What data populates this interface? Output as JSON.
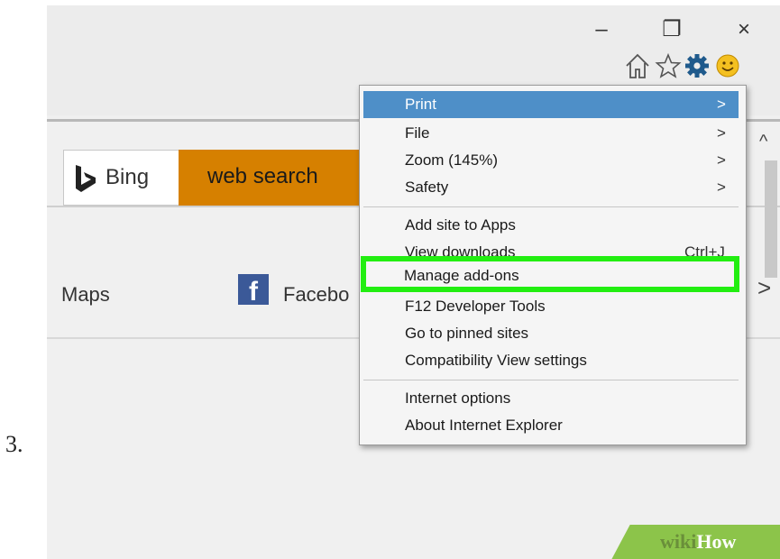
{
  "step_number": "3.",
  "window_controls": {
    "minimize": "–",
    "restore": "❐",
    "close": "×"
  },
  "toolbar_icons": [
    "home-icon",
    "star-icon",
    "gear-icon",
    "smiley-icon"
  ],
  "search": {
    "brand": "Bing",
    "button": "web search"
  },
  "favorites": {
    "maps": "Maps",
    "facebook_glyph": "f",
    "facebook_label": "Facebo"
  },
  "menu": {
    "items": [
      {
        "label": "Print",
        "arrow": ">"
      },
      {
        "label": "File",
        "arrow": ">"
      },
      {
        "label": "Zoom (145%)",
        "arrow": ">"
      },
      {
        "label": "Safety",
        "arrow": ">"
      },
      {
        "label": "Add site to Apps"
      },
      {
        "label": "View downloads",
        "shortcut": "Ctrl+J"
      },
      {
        "label": "Manage add-ons"
      },
      {
        "label": "F12 Developer Tools"
      },
      {
        "label": "Go to pinned sites"
      },
      {
        "label": "Compatibility View settings"
      },
      {
        "label": "Internet options"
      },
      {
        "label": "About Internet Explorer"
      }
    ]
  },
  "scroll": {
    "up": "^",
    "right": ">"
  },
  "watermark": {
    "wiki": "wiki",
    "how": "How"
  },
  "colors": {
    "accent_menu": "#4e8fc8",
    "highlight": "#22ee11",
    "search_button": "#d68000"
  }
}
